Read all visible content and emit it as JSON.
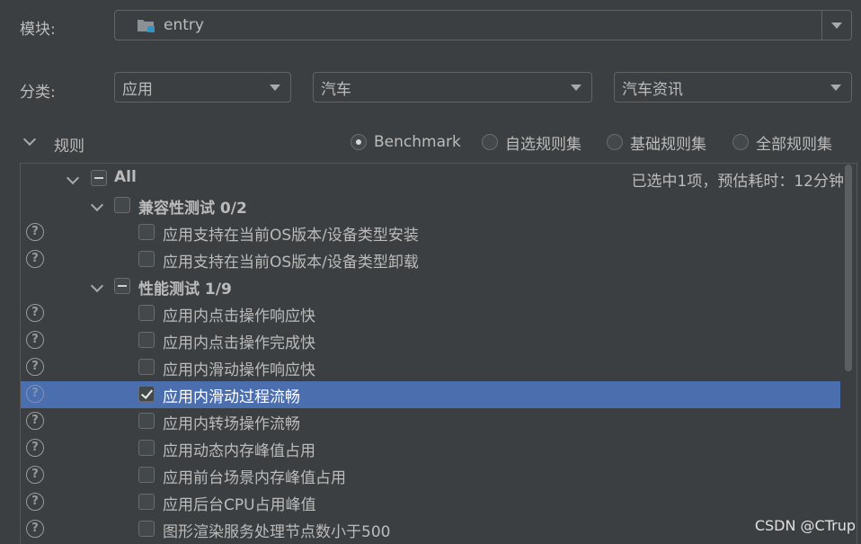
{
  "module": {
    "label": "模块:",
    "value": "entry"
  },
  "category": {
    "label": "分类:",
    "selects": [
      {
        "value": "应用"
      },
      {
        "value": "汽车"
      },
      {
        "value": "汽车资讯"
      }
    ]
  },
  "rules": {
    "label": "规则",
    "radio_options": [
      {
        "label": "Benchmark",
        "selected": true
      },
      {
        "label": "自选规则集",
        "selected": false
      },
      {
        "label": "基础规则集",
        "selected": false
      },
      {
        "label": "全部规则集",
        "selected": false
      }
    ],
    "summary": "已选中1项，预估耗时：12分钟"
  },
  "tree": {
    "root_label": "All",
    "groups": [
      {
        "label": "兼容性测试 0/2",
        "items": [
          {
            "label": "应用支持在当前OS版本/设备类型安装",
            "checked": false
          },
          {
            "label": "应用支持在当前OS版本/设备类型卸载",
            "checked": false
          }
        ]
      },
      {
        "label": "性能测试 1/9",
        "items": [
          {
            "label": "应用内点击操作响应快",
            "checked": false
          },
          {
            "label": "应用内点击操作完成快",
            "checked": false
          },
          {
            "label": "应用内滑动操作响应快",
            "checked": false
          },
          {
            "label": "应用内滑动过程流畅",
            "checked": true
          },
          {
            "label": "应用内转场操作流畅",
            "checked": false
          },
          {
            "label": "应用动态内存峰值占用",
            "checked": false
          },
          {
            "label": "应用前台场景内存峰值占用",
            "checked": false
          },
          {
            "label": "应用后台CPU占用峰值",
            "checked": false
          },
          {
            "label": "图形渲染服务处理节点数小于500",
            "checked": false
          }
        ]
      }
    ]
  },
  "watermark": "CSDN @CTrup",
  "colors": {
    "background": "#3c3f41",
    "selection": "#4b6eaf",
    "text": "#bbbbbb"
  },
  "icons": {
    "module": "module-folder-icon",
    "help": "help-circle-icon",
    "expand": "chevron-down-icon"
  }
}
